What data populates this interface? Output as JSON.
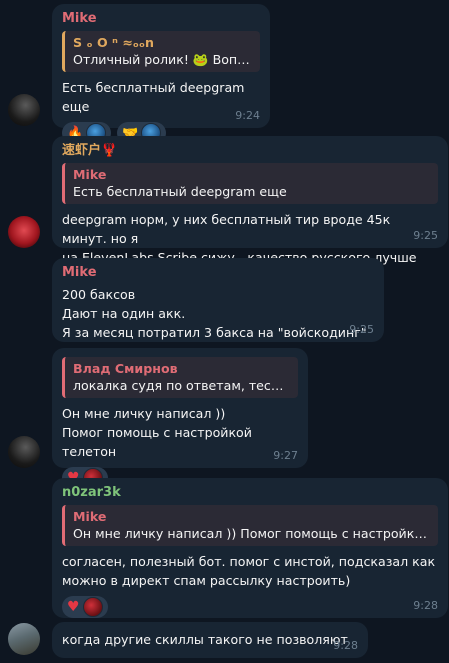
{
  "messages": [
    {
      "sender": "Mike",
      "sender_color": "#e06c75",
      "reply": {
        "name": "S ₒ O ⁿ ≈ₒₒn",
        "text": "Отличный ролик! 🐸 Вопр..."
      },
      "text": "Есть бесплатный deepgram еще",
      "reactions": [
        "🔥🤬",
        "🤝🤬"
      ],
      "time": "9:24"
    },
    {
      "sender": "速虾户🦞",
      "sender_color": "#e0a85e",
      "reply": {
        "name": "Mike",
        "text": "Есть бесплатный deepgram еще"
      },
      "text": "deepgram норм, у них бесплатный тир вроде 45к минут. но я\nна ElevenLabs Scribe сижу - качество русского лучше",
      "time": "9:25"
    },
    {
      "sender": "Mike",
      "sender_color": "#e06c75",
      "text": "200 баксов\nДают на один акк.\nЯ за месяц потратил 3 бакса на \"войскодинг\"",
      "time": "9:25"
    },
    {
      "reply": {
        "name": "Влад Смирнов",
        "text": "локалка судя по ответам, тестят в..."
      },
      "text": "Он мне личку написал ))\nПомог помощь с настройкой телетон",
      "reactions": [
        "❤️"
      ],
      "time": "9:27"
    },
    {
      "sender": "n0zar3k",
      "sender_color": "#7fc47a",
      "reply": {
        "name": "Mike",
        "text": "Он мне личку написал ))  Помог помощь с настройкой т..."
      },
      "text": "согласен, полезный бот. помог с инстой, подсказал как\nможно в директ спам рассылку настроить)",
      "reactions": [
        "❤️"
      ],
      "time": "9:28"
    },
    {
      "text": "когда другие скиллы такого не позволяют",
      "time": "9:28"
    }
  ]
}
